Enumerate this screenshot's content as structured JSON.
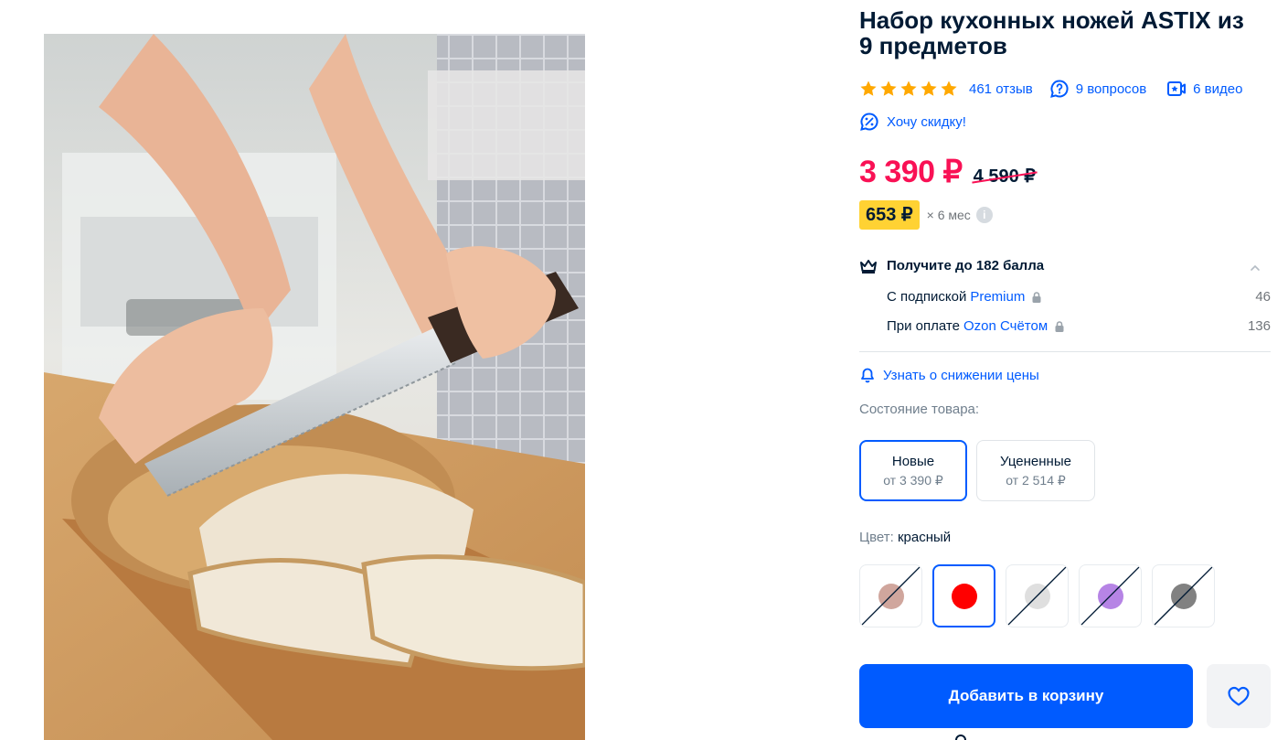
{
  "product": {
    "title": "Набор кухонных ножей ASTIX из 9 предметов",
    "rating_stars": 5,
    "reviews": "461 отзыв",
    "questions": "9 вопросов",
    "videos": "6 видео",
    "want_discount": "Хочу скидку!"
  },
  "price": {
    "current": "3 390 ₽",
    "old": "4 590 ₽",
    "installment": "653 ₽",
    "installment_term": "× 6 мес"
  },
  "points": {
    "title": "Получите до 182 балла",
    "lines": [
      {
        "prefix": "С подпиской",
        "link": "Premium",
        "value": "46"
      },
      {
        "prefix": "При оплате",
        "link": "Ozon Счётом",
        "value": "136"
      }
    ]
  },
  "notify_price_drop": "Узнать о снижении цены",
  "condition": {
    "label": "Состояние товара:",
    "options": [
      {
        "name": "Новые",
        "price": "от 3 390 ₽",
        "selected": true
      },
      {
        "name": "Уцененные",
        "price": "от 2 514 ₽",
        "selected": false
      }
    ]
  },
  "color": {
    "label": "Цвет:",
    "value": "красный",
    "swatches": [
      {
        "color": "#c8968c",
        "available": false,
        "selected": false
      },
      {
        "color": "#ff0000",
        "available": true,
        "selected": true
      },
      {
        "color": "#d9d9d9",
        "available": false,
        "selected": false
      },
      {
        "color": "#a96ee0",
        "available": false,
        "selected": false
      },
      {
        "color": "#6b6b6b",
        "available": false,
        "selected": false
      }
    ]
  },
  "actions": {
    "add_to_cart": "Добавить в корзину"
  },
  "icons": {
    "star": "star-icon",
    "questions": "question-bubble-icon",
    "videos": "video-icon",
    "discount": "discount-bubble-icon",
    "points": "crown-icon",
    "collapse": "chevron-up-icon",
    "lock": "lock-icon",
    "notify": "bell-icon",
    "favorite": "heart-icon",
    "info": "info-icon"
  },
  "colors": {
    "accent": "#005bff",
    "price": "#f91155",
    "installment_badge": "#ffd233",
    "text": "#001a34",
    "muted": "#707f8d"
  }
}
